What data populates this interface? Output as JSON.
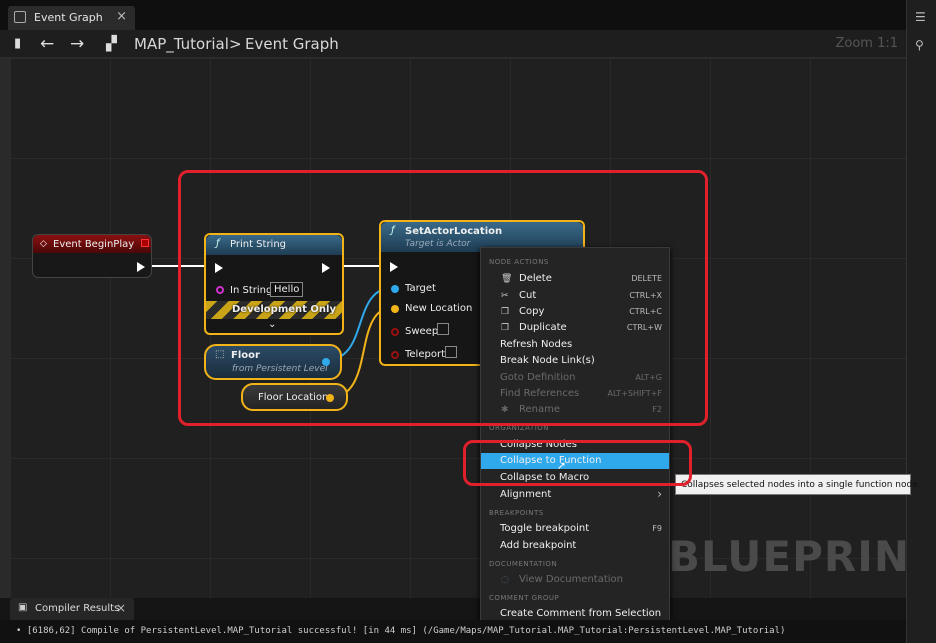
{
  "tab": {
    "title": "Event Graph",
    "close": "×"
  },
  "toolbar": {
    "back": "←",
    "forward": "→",
    "crumb_root": "MAP_Tutorial",
    "crumb_sep": ">",
    "crumb_leaf": "Event Graph",
    "zoom": "Zoom 1:1"
  },
  "nodes": {
    "begin_play": {
      "title": "Event BeginPlay"
    },
    "print_string": {
      "title": "Print String",
      "in_string_label": "In String",
      "in_string_value": "Hello",
      "dev_only": "Development Only",
      "expand": "⌄"
    },
    "set_actor_location": {
      "title": "SetActorLocation",
      "subtitle": "Target is Actor",
      "target": "Target",
      "new_location": "New Location",
      "sweep": "Sweep",
      "teleport": "Teleport"
    },
    "floor": {
      "title": "Floor",
      "subtitle": "from Persistent Level"
    },
    "floor_location": {
      "title": "Floor Location"
    }
  },
  "menu": {
    "sections": {
      "node_actions": "NODE ACTIONS",
      "organization": "ORGANIZATION",
      "breakpoints": "BREAKPOINTS",
      "documentation": "DOCUMENTATION",
      "comment_group": "COMMENT GROUP"
    },
    "items": [
      {
        "label": "Delete",
        "shortcut": "DELETE",
        "disabled": false
      },
      {
        "label": "Cut",
        "shortcut": "CTRL+X",
        "disabled": false
      },
      {
        "label": "Copy",
        "shortcut": "CTRL+C",
        "disabled": false
      },
      {
        "label": "Duplicate",
        "shortcut": "CTRL+W",
        "disabled": false
      },
      {
        "label": "Refresh Nodes",
        "shortcut": "",
        "disabled": false
      },
      {
        "label": "Break Node Link(s)",
        "shortcut": "",
        "disabled": false
      },
      {
        "label": "Goto Definition",
        "shortcut": "ALT+G",
        "disabled": true
      },
      {
        "label": "Find References",
        "shortcut": "ALT+SHIFT+F",
        "disabled": true
      },
      {
        "label": "Rename",
        "shortcut": "F2",
        "disabled": true
      },
      {
        "label": "Collapse Nodes",
        "shortcut": "",
        "disabled": false
      },
      {
        "label": "Collapse to Function",
        "shortcut": "",
        "disabled": false,
        "selected": true
      },
      {
        "label": "Collapse to Macro",
        "shortcut": "",
        "disabled": false
      },
      {
        "label": "Alignment",
        "shortcut": "›",
        "disabled": false
      },
      {
        "label": "Toggle breakpoint",
        "shortcut": "F9",
        "disabled": false
      },
      {
        "label": "Add breakpoint",
        "shortcut": "",
        "disabled": false
      },
      {
        "label": "View Documentation",
        "shortcut": "",
        "disabled": true
      },
      {
        "label": "Create Comment from Selection",
        "shortcut": "",
        "disabled": false
      }
    ]
  },
  "tooltip": "Collapses selected nodes into a single function node.",
  "watermark": "BLUEPRINT",
  "bottom": {
    "tab_label": "Compiler Results",
    "tab_close": "×",
    "log": "• [6186,62] Compile of PersistentLevel.MAP_Tutorial successful! [in 44 ms] (/Game/Maps/MAP_Tutorial.MAP_Tutorial:PersistentLevel.MAP_Tutorial)"
  },
  "colors": {
    "accent": "#2fa9ec",
    "highlight": "#e0202a",
    "selection": "#f2b319"
  }
}
